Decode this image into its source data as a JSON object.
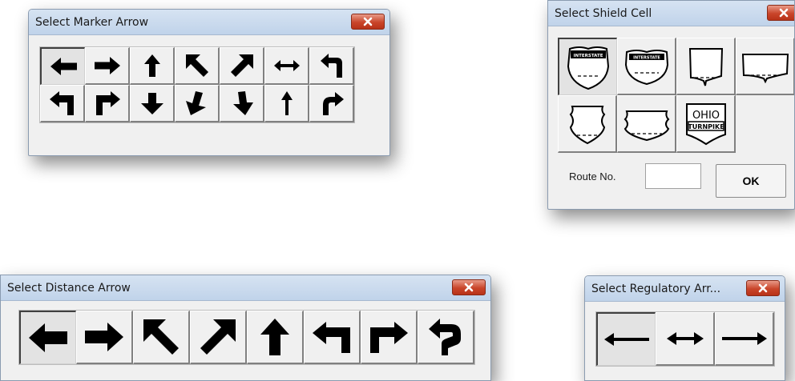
{
  "marker_dialog": {
    "title": "Select Marker Arrow",
    "row1_icons": [
      "left-arrow",
      "right-arrow",
      "up-arrow",
      "up-left-arrow",
      "up-right-arrow",
      "left-right-arrow",
      "turn-left-arrow"
    ],
    "row2_icons": [
      "left-turn-bold-arrow",
      "right-turn-bold-arrow",
      "down-arrow",
      "down-left-arrow",
      "down-right-arrow",
      "up-thin-arrow",
      "curve-right-arrow"
    ]
  },
  "shield_dialog": {
    "title": "Select Shield Cell",
    "shield_icons": [
      "interstate-shield",
      "interstate-wide-shield",
      "state-shield",
      "state-wide-shield",
      "us-route-shield",
      "us-route-wide-shield",
      "ohio-turnpike-shield"
    ],
    "interstate_text": "INTERSTATE",
    "ohio_text": "OHIO",
    "turnpike_text": "TURNPIKE",
    "route_label": "Route No.",
    "route_value": "",
    "ok_label": "OK"
  },
  "distance_dialog": {
    "title": "Select Distance Arrow",
    "icons": [
      "left-arrow",
      "right-arrow",
      "up-left-arrow",
      "up-right-arrow",
      "up-arrow",
      "turn-left-arrow",
      "turn-right-arrow",
      "u-turn-arrow"
    ]
  },
  "regulatory_dialog": {
    "title": "Select Regulatory Arr...",
    "icons": [
      "left-thin-arrow",
      "left-right-thin-arrow",
      "right-thin-arrow"
    ]
  }
}
